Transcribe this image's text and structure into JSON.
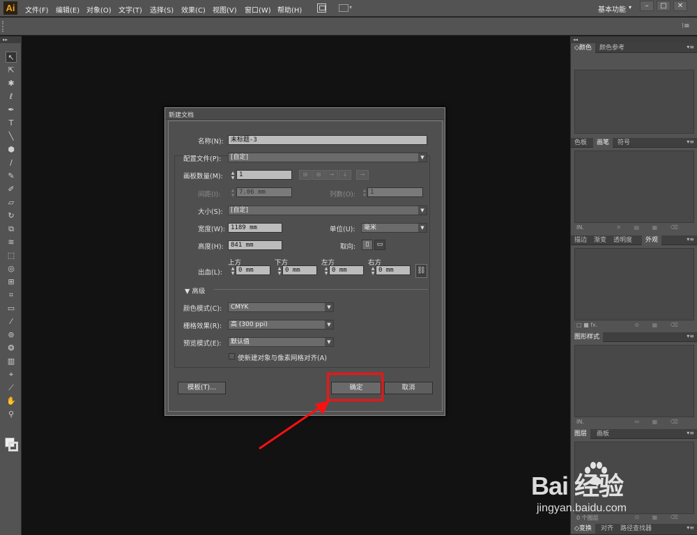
{
  "app": {
    "logo": "Ai"
  },
  "menu": [
    "文件(F)",
    "编辑(E)",
    "对象(O)",
    "文字(T)",
    "选择(S)",
    "效果(C)",
    "视图(V)",
    "窗口(W)",
    "帮助(H)"
  ],
  "workspace": {
    "label": "基本功能",
    "arrow": "▾"
  },
  "window_controls": {
    "minimize": "–",
    "maximize": "□",
    "close": "✕"
  },
  "strips": {
    "collapse_left": "▸▸",
    "collapse_right": "◂◂",
    "panel_menu": "▾≡",
    "panel_flyout": "▾≡"
  },
  "tools": [
    {
      "icon": "selection-tool-icon",
      "glyph": "↖"
    },
    {
      "icon": "direct-selection-tool-icon",
      "glyph": "⇱"
    },
    {
      "icon": "magic-wand-tool-icon",
      "glyph": "✱"
    },
    {
      "icon": "lasso-tool-icon",
      "glyph": "ℓ"
    },
    {
      "icon": "pen-tool-icon",
      "glyph": "✒"
    },
    {
      "icon": "type-tool-icon",
      "glyph": "T"
    },
    {
      "icon": "line-tool-icon",
      "glyph": "╲"
    },
    {
      "icon": "rectangle-tool-icon",
      "glyph": "⬢"
    },
    {
      "icon": "paintbrush-tool-icon",
      "glyph": "/"
    },
    {
      "icon": "pencil-tool-icon",
      "glyph": "✎"
    },
    {
      "icon": "blob-brush-tool-icon",
      "glyph": "✐"
    },
    {
      "icon": "eraser-tool-icon",
      "glyph": "▱"
    },
    {
      "icon": "rotate-tool-icon",
      "glyph": "↻"
    },
    {
      "icon": "scale-tool-icon",
      "glyph": "⧉"
    },
    {
      "icon": "warp-tool-icon",
      "glyph": "≋"
    },
    {
      "icon": "free-transform-tool-icon",
      "glyph": "⬚"
    },
    {
      "icon": "shape-builder-tool-icon",
      "glyph": "◎"
    },
    {
      "icon": "perspective-grid-tool-icon",
      "glyph": "⊞"
    },
    {
      "icon": "mesh-tool-icon",
      "glyph": "⌗"
    },
    {
      "icon": "gradient-tool-icon",
      "glyph": "▭"
    },
    {
      "icon": "eyedropper-tool-icon",
      "glyph": "⁄"
    },
    {
      "icon": "blend-tool-icon",
      "glyph": "⊚"
    },
    {
      "icon": "symbol-sprayer-tool-icon",
      "glyph": "❂"
    },
    {
      "icon": "column-graph-tool-icon",
      "glyph": "▥"
    },
    {
      "icon": "artboard-tool-icon",
      "glyph": "⌖"
    },
    {
      "icon": "slice-tool-icon",
      "glyph": "⟋"
    },
    {
      "icon": "hand-tool-icon",
      "glyph": "✋"
    },
    {
      "icon": "zoom-tool-icon",
      "glyph": "⚲"
    }
  ],
  "panels": {
    "color": {
      "tabs": [
        "颜色",
        "颜色参考"
      ],
      "tab_prefix": "◇"
    },
    "brush": {
      "tabs": [
        "色板",
        "画笔",
        "符号"
      ],
      "foot_left": "IN.",
      "foot_icons": "✕ ▤ ▦ ⌫"
    },
    "appearance": {
      "tabs": [
        "描边",
        "渐变",
        "透明度",
        "外观"
      ],
      "foot_left": "□ ■ fx.",
      "foot_icons": "⊘ ▦ ⌫"
    },
    "graphic_styles": {
      "tabs": [
        "图形样式"
      ],
      "foot_left": "IN.",
      "foot_icons": "⇔ ▦ ⌫"
    },
    "layers": {
      "tabs": [
        "图层",
        "画板"
      ],
      "foot_left": "0 个图层",
      "foot_icons": "⊙ ▦ ⌫"
    },
    "bottom": {
      "tabs": [
        "◇变换",
        "对齐",
        "路径查找器"
      ]
    }
  },
  "dialog": {
    "title": "新建文档",
    "name_label": "名称(N):",
    "name_value": "未标题-3",
    "profile_label": "配置文件(P):",
    "profile_value": "[自定]",
    "artboards_label": "画板数量(M):",
    "artboards_value": "1",
    "spacing_label": "间距(I):",
    "spacing_value": "7.06 mm",
    "columns_label": "列数(O):",
    "columns_value": "1",
    "size_label": "大小(S):",
    "size_value": "[自定]",
    "width_label": "宽度(W):",
    "width_value": "1189 mm",
    "units_label": "单位(U):",
    "units_value": "毫米",
    "height_label": "高度(H):",
    "height_value": "841 mm",
    "orientation_label": "取向:",
    "bleed_label": "出血(L):",
    "bleed_top_label": "上方",
    "bleed_top_value": "0 mm",
    "bleed_bottom_label": "下方",
    "bleed_bottom_value": "0 mm",
    "bleed_left_label": "左方",
    "bleed_left_value": "0 mm",
    "bleed_right_label": "右方",
    "bleed_right_value": "0 mm",
    "advanced_label": "高级",
    "color_mode_label": "颜色模式(C):",
    "color_mode_value": "CMYK",
    "raster_label": "栅格效果(R):",
    "raster_value": "高 (300 ppi)",
    "preview_label": "预览模式(E):",
    "preview_value": "默认值",
    "align_pixel_label": "使新建对象与像素网格对齐(A)",
    "template_button": "模板(T)...",
    "ok_button": "确定",
    "cancel_button": "取消"
  },
  "watermark": {
    "brand": "Bai  经验",
    "url": "jingyan.baidu.com"
  },
  "annotation": {
    "highlight_color": "#ff1010"
  }
}
